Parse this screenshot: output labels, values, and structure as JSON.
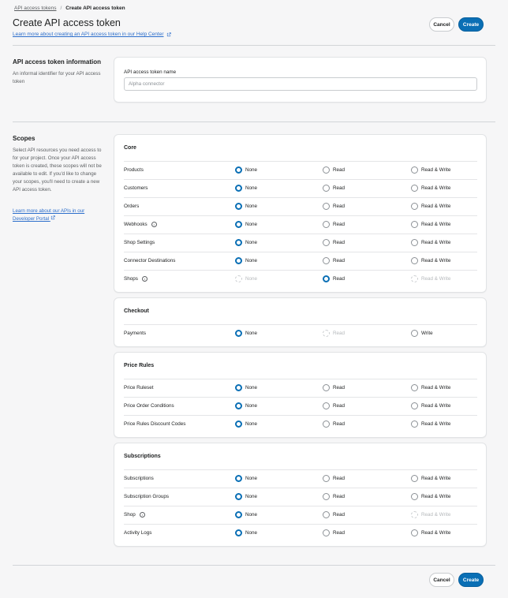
{
  "breadcrumb": {
    "parent": "API access tokens",
    "separator": "/",
    "current": "Create API access token"
  },
  "header": {
    "title": "Create API access token",
    "help_link": "Learn more about creating an API access token in our Help Center",
    "cancel": "Cancel",
    "create": "Create"
  },
  "info_section": {
    "title": "API access token information",
    "description": "An informal identifier for your API access token",
    "field_label": "API access token name",
    "field_value": "",
    "field_placeholder": "Alpha connector"
  },
  "scopes_section": {
    "title": "Scopes",
    "description": "Select API resources you need access to for your project. Once your API access token is created, these scopes will not be available to edit. If you'd like to change your scopes, you'll need to create a new API access token.",
    "link": "Learn more about our APIs in our Developer Portal"
  },
  "cards": [
    {
      "heading": "Core",
      "rows": [
        {
          "label": "Products",
          "info": false,
          "options": [
            "None",
            "Read",
            "Read & Write"
          ],
          "selected": 0,
          "disabled": []
        },
        {
          "label": "Customers",
          "info": false,
          "options": [
            "None",
            "Read",
            "Read & Write"
          ],
          "selected": 0,
          "disabled": []
        },
        {
          "label": "Orders",
          "info": false,
          "options": [
            "None",
            "Read",
            "Read & Write"
          ],
          "selected": 0,
          "disabled": []
        },
        {
          "label": "Webhooks",
          "info": true,
          "options": [
            "None",
            "Read",
            "Read & Write"
          ],
          "selected": 0,
          "disabled": []
        },
        {
          "label": "Shop Settings",
          "info": false,
          "options": [
            "None",
            "Read",
            "Read & Write"
          ],
          "selected": 0,
          "disabled": []
        },
        {
          "label": "Connector Destinations",
          "info": false,
          "options": [
            "None",
            "Read",
            "Read & Write"
          ],
          "selected": 0,
          "disabled": []
        },
        {
          "label": "Shops",
          "info": true,
          "options": [
            "None",
            "Read",
            "Read & Write"
          ],
          "selected": 1,
          "disabled": [
            0,
            2
          ]
        }
      ]
    },
    {
      "heading": "Checkout",
      "rows": [
        {
          "label": "Payments",
          "info": false,
          "options": [
            "None",
            "Read",
            "Write"
          ],
          "selected": 0,
          "disabled": [
            1
          ]
        }
      ]
    },
    {
      "heading": "Price Rules",
      "rows": [
        {
          "label": "Price Ruleset",
          "info": false,
          "options": [
            "None",
            "Read",
            "Read & Write"
          ],
          "selected": 0,
          "disabled": []
        },
        {
          "label": "Price Order Conditions",
          "info": false,
          "options": [
            "None",
            "Read",
            "Read & Write"
          ],
          "selected": 0,
          "disabled": []
        },
        {
          "label": "Price Rules Discount Codes",
          "info": false,
          "options": [
            "None",
            "Read",
            "Read & Write"
          ],
          "selected": 0,
          "disabled": []
        }
      ]
    },
    {
      "heading": "Subscriptions",
      "rows": [
        {
          "label": "Subscriptions",
          "info": false,
          "options": [
            "None",
            "Read",
            "Read & Write"
          ],
          "selected": 0,
          "disabled": []
        },
        {
          "label": "Subscription Groups",
          "info": false,
          "options": [
            "None",
            "Read",
            "Read & Write"
          ],
          "selected": 0,
          "disabled": []
        },
        {
          "label": "Shop",
          "info": true,
          "options": [
            "None",
            "Read",
            "Read & Write"
          ],
          "selected": 0,
          "disabled": [
            2
          ]
        },
        {
          "label": "Activity Logs",
          "info": false,
          "options": [
            "None",
            "Read",
            "Read & Write"
          ],
          "selected": 0,
          "disabled": []
        }
      ]
    }
  ],
  "footer": {
    "cancel": "Cancel",
    "create": "Create"
  },
  "colors": {
    "accent": "#0a6fb5",
    "link": "#2c6ecb",
    "background": "#f6f6f7"
  }
}
